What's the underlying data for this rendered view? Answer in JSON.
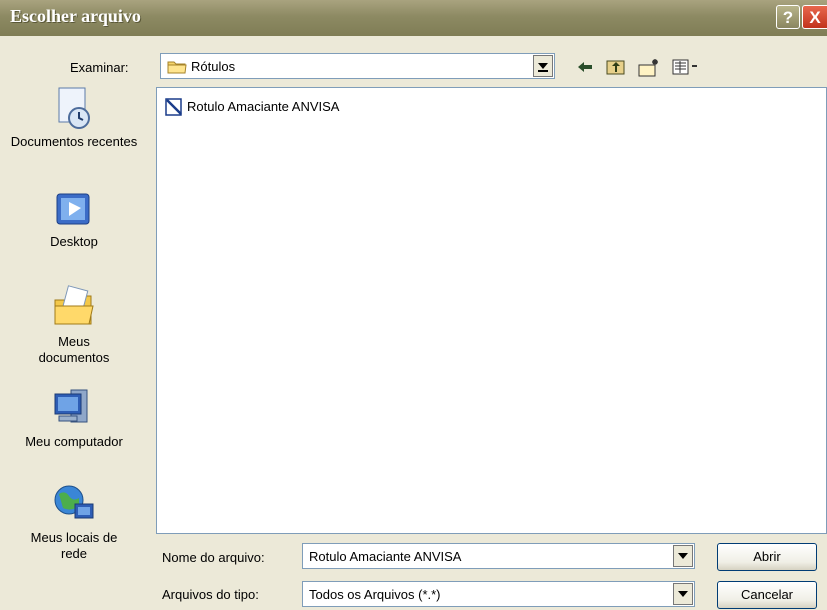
{
  "window": {
    "title": "Escolher arquivo",
    "help_label": "?",
    "close_label": "X"
  },
  "toolbar": {
    "lookin_label": "Examinar:",
    "lookin_value": "Rótulos",
    "icons": [
      "back-arrow-icon",
      "up-folder-icon",
      "new-folder-icon",
      "view-menu-icon"
    ]
  },
  "places": [
    {
      "label": "Documentos recentes",
      "icon": "recent-documents-icon"
    },
    {
      "label": "Desktop",
      "icon": "desktop-icon"
    },
    {
      "label": "Meus documentos",
      "icon": "my-documents-icon"
    },
    {
      "label": "Meu computador",
      "icon": "my-computer-icon"
    },
    {
      "label": "Meus locais de rede",
      "icon": "network-places-icon"
    }
  ],
  "files": [
    {
      "name": "Rotulo Amaciante ANVISA",
      "icon": "document-icon"
    }
  ],
  "footer": {
    "filename_label": "Nome do arquivo:",
    "filename_value": "Rotulo Amaciante ANVISA",
    "filetype_label": "Arquivos do tipo:",
    "filetype_value": "Todos os Arquivos (*.*)",
    "open_label": "Abrir",
    "cancel_label": "Cancelar"
  }
}
